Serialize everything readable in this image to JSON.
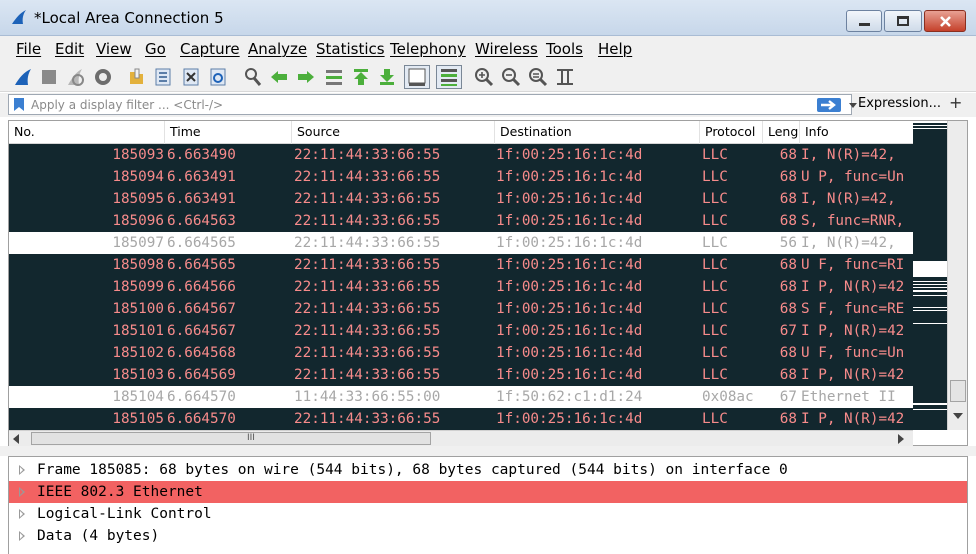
{
  "window": {
    "title": "*Local Area Connection 5"
  },
  "menu": [
    "File",
    "Edit",
    "View",
    "Go",
    "Capture",
    "Analyze",
    "Statistics",
    "Telephony",
    "Wireless",
    "Tools",
    "Help"
  ],
  "toolbar": {
    "icons": [
      "shark-fin-start-icon",
      "stop-icon",
      "restart-icon",
      "capture-options-icon",
      "open-folder-icon",
      "save-file-icon",
      "close-file-icon",
      "reload-icon",
      "find-packet-icon",
      "go-back-icon",
      "go-forward-icon",
      "go-to-packet-icon",
      "go-first-icon",
      "go-last-icon",
      "auto-scroll-icon",
      "colorize-icon",
      "zoom-in-icon",
      "zoom-out-icon",
      "zoom-normal-icon",
      "resize-columns-icon"
    ]
  },
  "filter": {
    "placeholder": "Apply a display filter ... <Ctrl-/>",
    "expression_label": "Expression...",
    "plus_label": "+"
  },
  "packet_list": {
    "columns": [
      "No.",
      "Time",
      "Source",
      "Destination",
      "Protocol",
      "Leng",
      "Info"
    ],
    "rows": [
      {
        "no": "185093",
        "time": "6.663490",
        "src": "22:11:44:33:66:55",
        "dst": "1f:00:25:16:1c:4d",
        "proto": "LLC",
        "len": "68",
        "info": "I, N(R)=42, ",
        "style": "dark"
      },
      {
        "no": "185094",
        "time": "6.663491",
        "src": "22:11:44:33:66:55",
        "dst": "1f:00:25:16:1c:4d",
        "proto": "LLC",
        "len": "68",
        "info": "U P, func=Un",
        "style": "dark"
      },
      {
        "no": "185095",
        "time": "6.663491",
        "src": "22:11:44:33:66:55",
        "dst": "1f:00:25:16:1c:4d",
        "proto": "LLC",
        "len": "68",
        "info": "I, N(R)=42, ",
        "style": "dark"
      },
      {
        "no": "185096",
        "time": "6.664563",
        "src": "22:11:44:33:66:55",
        "dst": "1f:00:25:16:1c:4d",
        "proto": "LLC",
        "len": "68",
        "info": "S, func=RNR,",
        "style": "dark"
      },
      {
        "no": "185097",
        "time": "6.664565",
        "src": "22:11:44:33:66:55",
        "dst": "1f:00:25:16:1c:4d",
        "proto": "LLC",
        "len": "56",
        "info": "I, N(R)=42, ",
        "style": "light"
      },
      {
        "no": "185098",
        "time": "6.664565",
        "src": "22:11:44:33:66:55",
        "dst": "1f:00:25:16:1c:4d",
        "proto": "LLC",
        "len": "68",
        "info": "U F, func=RI",
        "style": "dark"
      },
      {
        "no": "185099",
        "time": "6.664566",
        "src": "22:11:44:33:66:55",
        "dst": "1f:00:25:16:1c:4d",
        "proto": "LLC",
        "len": "68",
        "info": "I P, N(R)=42",
        "style": "dark"
      },
      {
        "no": "185100",
        "time": "6.664567",
        "src": "22:11:44:33:66:55",
        "dst": "1f:00:25:16:1c:4d",
        "proto": "LLC",
        "len": "68",
        "info": "S F, func=RE",
        "style": "dark"
      },
      {
        "no": "185101",
        "time": "6.664567",
        "src": "22:11:44:33:66:55",
        "dst": "1f:00:25:16:1c:4d",
        "proto": "LLC",
        "len": "67",
        "info": "I P, N(R)=42",
        "style": "dark"
      },
      {
        "no": "185102",
        "time": "6.664568",
        "src": "22:11:44:33:66:55",
        "dst": "1f:00:25:16:1c:4d",
        "proto": "LLC",
        "len": "68",
        "info": "U F, func=Un",
        "style": "dark"
      },
      {
        "no": "185103",
        "time": "6.664569",
        "src": "22:11:44:33:66:55",
        "dst": "1f:00:25:16:1c:4d",
        "proto": "LLC",
        "len": "68",
        "info": "I P, N(R)=42",
        "style": "dark"
      },
      {
        "no": "185104",
        "time": "6.664570",
        "src": "11:44:33:66:55:00",
        "dst": "1f:50:62:c1:d1:24",
        "proto": "0x08ac",
        "len": "67",
        "info": "Ethernet II",
        "style": "light"
      },
      {
        "no": "185105",
        "time": "6.664570",
        "src": "22:11:44:33:66:55",
        "dst": "1f:00:25:16:1c:4d",
        "proto": "LLC",
        "len": "68",
        "info": "I P, N(R)=42",
        "style": "dark"
      }
    ],
    "hscroll_grip": "III"
  },
  "details": [
    {
      "text": "Frame 185085: 68 bytes on wire (544 bits), 68 bytes captured (544 bits) on interface 0",
      "selected": false
    },
    {
      "text": "IEEE 802.3 Ethernet",
      "selected": true
    },
    {
      "text": "Logical-Link Control",
      "selected": false
    },
    {
      "text": "Data (4 bytes)",
      "selected": false
    }
  ],
  "colors": {
    "row_dark_bg": "#12272e",
    "row_dark_fg": "#f78b8b",
    "row_light_fg": "#a7a7a7",
    "selected_detail": "#f26262"
  }
}
